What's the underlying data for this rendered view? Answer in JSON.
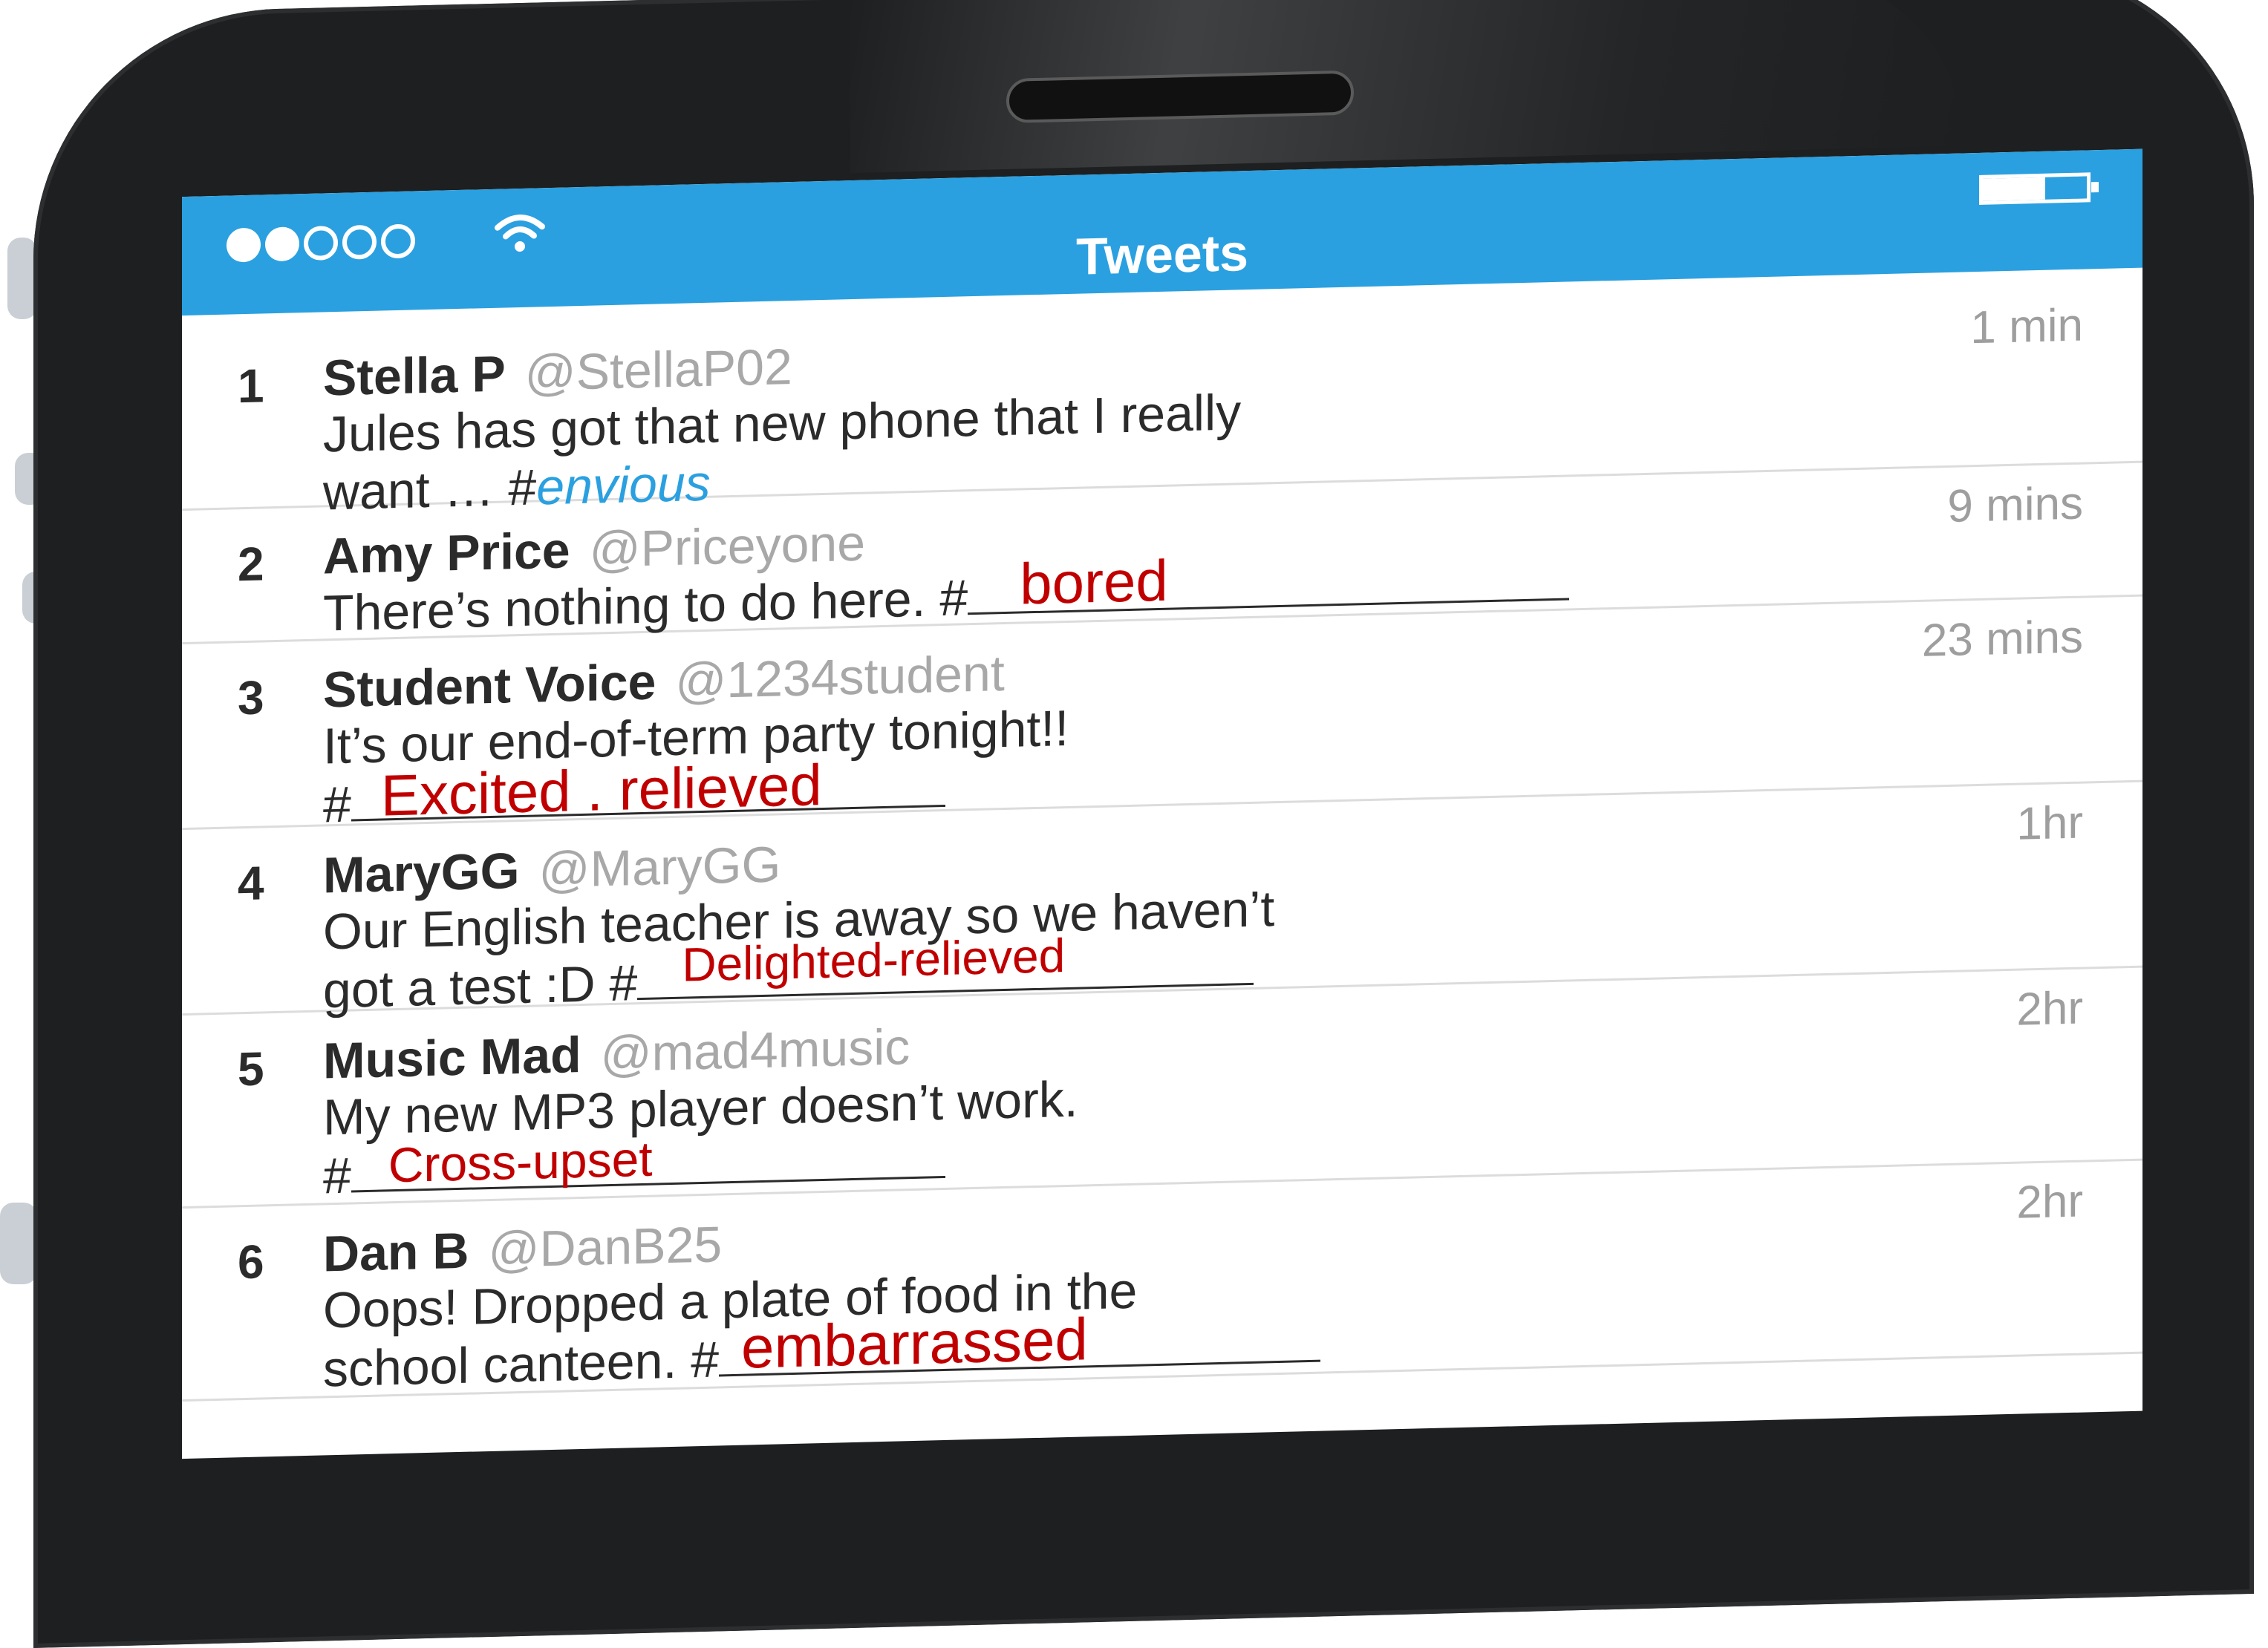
{
  "statusbar": {
    "signal_dots": [
      true,
      true,
      false,
      false,
      false
    ],
    "wifi_icon": "wifi-icon",
    "battery_level": 0.6
  },
  "header": {
    "title": "Tweets"
  },
  "tweets": [
    {
      "num": "1",
      "name": "Stella P",
      "handle": "@StellaP02",
      "time": "1 min",
      "line1": "Jules has got that new phone that I really",
      "line2_prefix": "want … #",
      "hashtag": "envious"
    },
    {
      "num": "2",
      "name": "Amy Price",
      "handle": "@Priceyone",
      "time": "9 mins",
      "line1": "There’s nothing to do here. #",
      "answer": "bored"
    },
    {
      "num": "3",
      "name": "Student Voice",
      "handle": "@1234student",
      "time": "23 mins",
      "line1": "It’s our end-of-term party tonight!!",
      "line2_prefix": "#",
      "answer": "Excited . relieved"
    },
    {
      "num": "4",
      "name": "MaryGG",
      "handle": "@MaryGG",
      "time": "1hr",
      "line1": "Our English teacher is away so we haven’t",
      "line2_prefix": "got a test :D #",
      "answer": "Delighted-relieved"
    },
    {
      "num": "5",
      "name": "Music Mad",
      "handle": "@mad4music",
      "time": "2hr",
      "line1": "My new MP3 player doesn’t work.",
      "line2_prefix": "#",
      "answer": "Cross-upset"
    },
    {
      "num": "6",
      "name": "Dan B",
      "handle": "@DanB25",
      "time": "2hr",
      "line1": "Oops! Dropped a plate of food in the",
      "line2_prefix": "school canteen. #",
      "answer": "embarrassed"
    }
  ]
}
